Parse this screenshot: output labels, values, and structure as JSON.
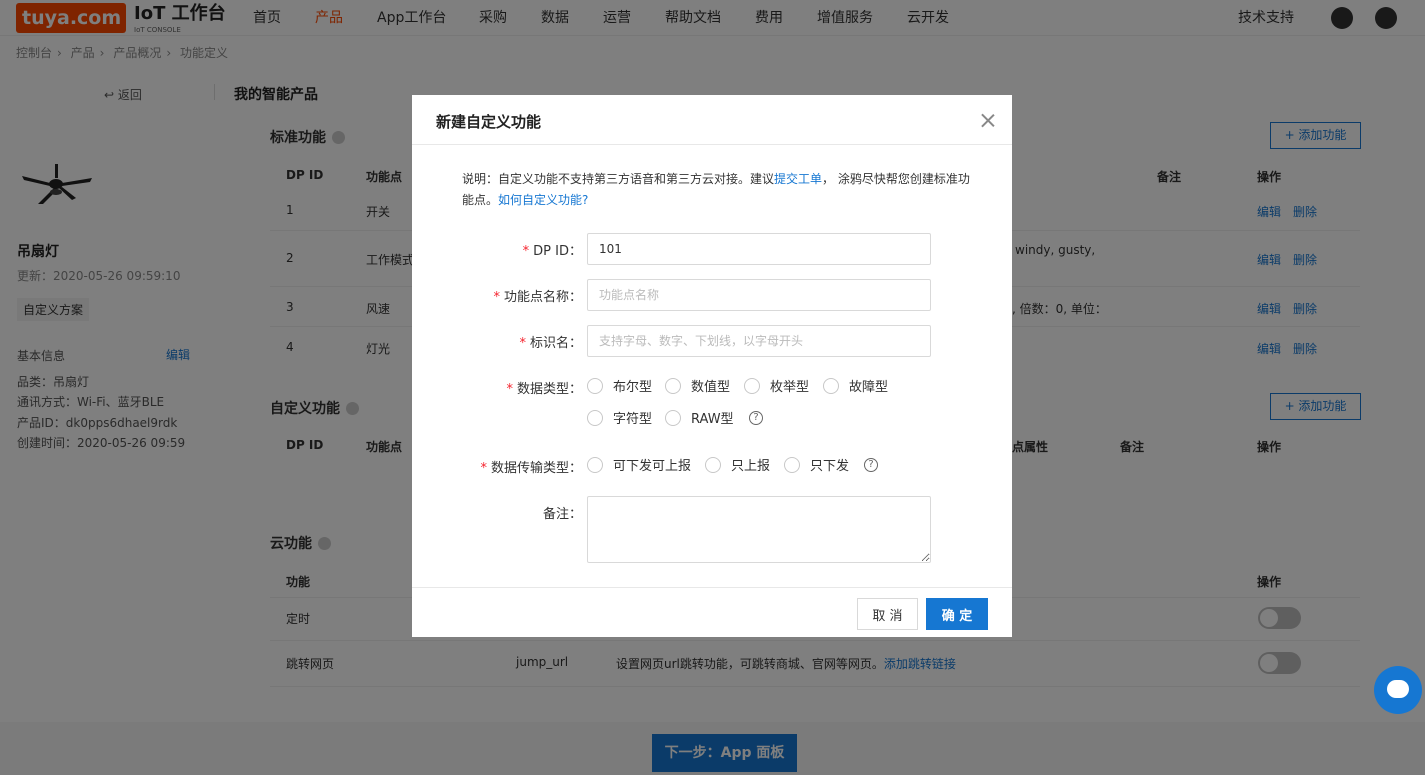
{
  "logo": "tuya.com",
  "console": {
    "title": "IoT 工作台",
    "subtitle": "IoT CONSOLE"
  },
  "nav": {
    "items": [
      "首页",
      "产品",
      "App工作台",
      "采购",
      "数据",
      "运营",
      "帮助文档",
      "费用",
      "增值服务",
      "云开发"
    ],
    "active": "产品",
    "support": "技术支持"
  },
  "breadcrumb": [
    "控制台",
    "产品",
    "产品概况",
    "功能定义"
  ],
  "sidebar": {
    "back": "返回",
    "product_name": "吊扇灯",
    "updated": "更新：2020-05-26 09:59:10",
    "tag": "自定义方案",
    "info_title": "基本信息",
    "edit": "编辑",
    "category": "品类：吊扇灯",
    "comm": "通讯方式：Wi-Fi、蓝牙BLE",
    "pid": "产品ID：dk0pps6dhael9rdk",
    "created": "创建时间：2020-05-26 09:59"
  },
  "main": {
    "title": "我的智能产品",
    "standard": {
      "title": "标准功能",
      "add": "+ 添加功能",
      "headers": {
        "dpid": "DP ID",
        "name": "功能点",
        "remark": "备注",
        "ops": "操作"
      },
      "rows": [
        {
          "id": "1",
          "name": "开关",
          "extra": ""
        },
        {
          "id": "2",
          "name": "工作模式",
          "extra": "windy, gusty,"
        },
        {
          "id": "3",
          "name": "风速",
          "extra": ", 倍数：0, 单位："
        },
        {
          "id": "4",
          "name": "灯光",
          "extra": ""
        }
      ],
      "edit": "编辑",
      "delete": "删除"
    },
    "custom": {
      "title": "自定义功能",
      "add": "+ 添加功能",
      "headers": {
        "dpid": "DP ID",
        "name": "功能点",
        "attr": "点属性",
        "remark": "备注",
        "ops": "操作"
      }
    },
    "cloud": {
      "title": "云功能",
      "headers": {
        "name": "功能",
        "ops": "操作"
      },
      "rows": [
        {
          "name": "定时",
          "code": "",
          "desc": "",
          "link": ""
        },
        {
          "name": "跳转网页",
          "code": "jump_url",
          "desc": "设置网页url跳转功能，可跳转商城、官网等网页。",
          "link": "添加跳转链接"
        }
      ]
    }
  },
  "footer": {
    "next": "下一步：App 面板"
  },
  "modal": {
    "title": "新建自定义功能",
    "notice_pre": "说明：自定义功能不支持第三方语音和第三方云对接。建议",
    "notice_link": "提交工单",
    "notice_mid": "， 涂鸦尽快帮您创建标准功能点。",
    "notice_link2": "如何自定义功能?",
    "fields": {
      "dpid_label": "DP ID：",
      "dpid_value": "101",
      "name_label": "功能点名称：",
      "name_placeholder": "功能点名称",
      "id_label": "标识名：",
      "id_placeholder": "支持字母、数字、下划线，以字母开头",
      "type_label": "数据类型：",
      "types": [
        "布尔型",
        "数值型",
        "枚举型",
        "故障型",
        "字符型",
        "RAW型"
      ],
      "trans_label": "数据传输类型：",
      "trans": [
        "可下发可上报",
        "只上报",
        "只下发"
      ],
      "remark_label": "备注："
    },
    "cancel": "取 消",
    "ok": "确 定"
  }
}
